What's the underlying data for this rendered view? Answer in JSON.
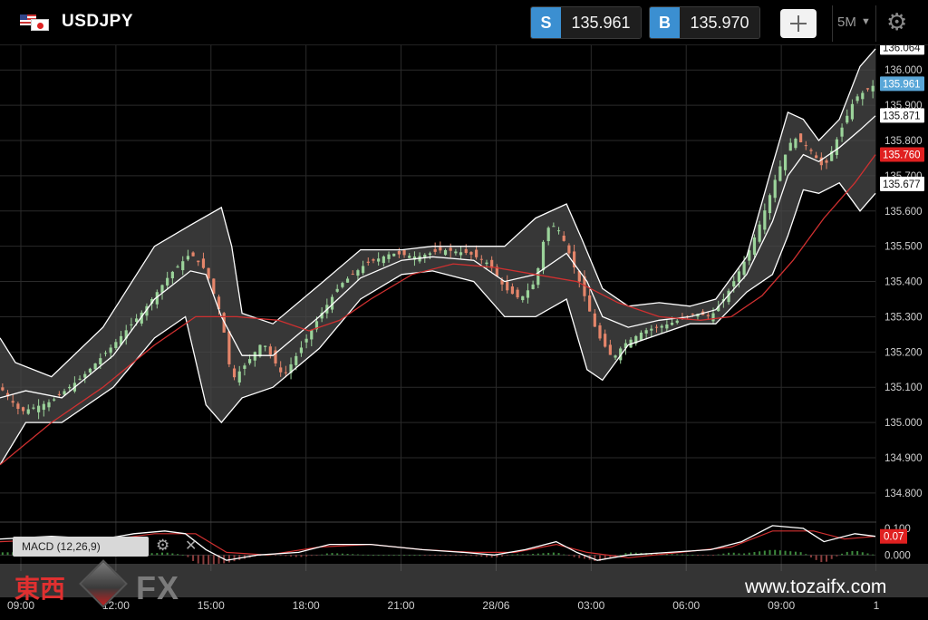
{
  "header": {
    "symbol": "USDJPY",
    "flags": [
      "us-flag",
      "jp-flag"
    ],
    "sell_tag": "S",
    "sell_price": "135.961",
    "buy_tag": "B",
    "buy_price": "135.970",
    "interval": "5M",
    "icons": [
      "crosshair-icon",
      "chevron-down-icon",
      "gear-icon"
    ]
  },
  "colors": {
    "accent": "#3b8fd1",
    "up_candle": "#9bd39a",
    "down_candle": "#e4856a",
    "band": "#ffffff",
    "ma_line": "#d03030",
    "price_tag_current": "#5aa7d8",
    "price_tag_red": "#e02020"
  },
  "macd": {
    "legend": "MACD (12,26,9)",
    "axis_labels": [
      "0.100",
      "0.000"
    ],
    "current_value": "0.07"
  },
  "watermark": {
    "kanji": "東西",
    "brand": "FX",
    "url": "www.tozaifx.com"
  },
  "chart_data": {
    "type": "candlestick",
    "title": "USDJPY",
    "interval": "5M",
    "y_ticks": [
      "136.000",
      "135.900",
      "135.800",
      "135.700",
      "135.600",
      "135.500",
      "135.400",
      "135.300",
      "135.200",
      "135.100",
      "135.000",
      "134.900",
      "134.800"
    ],
    "ylim": [
      134.72,
      136.07
    ],
    "x_ticks": [
      "09:00",
      "12:00",
      "15:00",
      "18:00",
      "21:00",
      "28/06",
      "03:00",
      "06:00",
      "09:00",
      "1"
    ],
    "price_labels": [
      {
        "label": "136.064",
        "value": 136.064,
        "style": "white"
      },
      {
        "label": "135.961",
        "value": 135.961,
        "style": "blue"
      },
      {
        "label": "135.871",
        "value": 135.871,
        "style": "white"
      },
      {
        "label": "135.760",
        "value": 135.76,
        "style": "red"
      },
      {
        "label": "135.677",
        "value": 135.677,
        "style": "white"
      }
    ],
    "close_path": [
      [
        0,
        135.1
      ],
      [
        4,
        135.03
      ],
      [
        10,
        135.06
      ],
      [
        16,
        135.13
      ],
      [
        22,
        135.22
      ],
      [
        28,
        135.32
      ],
      [
        33,
        135.42
      ],
      [
        37,
        135.48
      ],
      [
        40,
        135.43
      ],
      [
        43,
        135.3
      ],
      [
        45,
        135.12
      ],
      [
        48,
        135.17
      ],
      [
        51,
        135.23
      ],
      [
        55,
        135.13
      ],
      [
        58,
        135.2
      ],
      [
        62,
        135.3
      ],
      [
        66,
        135.39
      ],
      [
        71,
        135.45
      ],
      [
        76,
        135.48
      ],
      [
        81,
        135.47
      ],
      [
        86,
        135.49
      ],
      [
        91,
        135.48
      ],
      [
        95,
        135.45
      ],
      [
        98,
        135.38
      ],
      [
        101,
        135.35
      ],
      [
        104,
        135.4
      ],
      [
        106,
        135.55
      ],
      [
        108,
        135.56
      ],
      [
        110,
        135.5
      ],
      [
        113,
        135.38
      ],
      [
        116,
        135.25
      ],
      [
        119,
        135.18
      ],
      [
        121,
        135.22
      ],
      [
        125,
        135.26
      ],
      [
        130,
        135.28
      ],
      [
        135,
        135.31
      ],
      [
        138,
        135.3
      ],
      [
        141,
        135.36
      ],
      [
        145,
        135.47
      ],
      [
        148,
        135.58
      ],
      [
        151,
        135.71
      ],
      [
        154,
        135.81
      ],
      [
        157,
        135.78
      ],
      [
        160,
        135.72
      ],
      [
        163,
        135.82
      ],
      [
        166,
        135.92
      ],
      [
        170,
        135.96
      ]
    ],
    "bollinger_upper": [
      [
        0,
        135.24
      ],
      [
        3,
        135.17
      ],
      [
        10,
        135.13
      ],
      [
        20,
        135.27
      ],
      [
        30,
        135.5
      ],
      [
        37,
        135.56
      ],
      [
        43,
        135.61
      ],
      [
        45,
        135.5
      ],
      [
        47,
        135.31
      ],
      [
        53,
        135.28
      ],
      [
        62,
        135.39
      ],
      [
        70,
        135.49
      ],
      [
        78,
        135.49
      ],
      [
        84,
        135.5
      ],
      [
        92,
        135.5
      ],
      [
        98,
        135.5
      ],
      [
        104,
        135.58
      ],
      [
        110,
        135.62
      ],
      [
        113,
        135.52
      ],
      [
        117,
        135.38
      ],
      [
        122,
        135.33
      ],
      [
        128,
        135.34
      ],
      [
        134,
        135.33
      ],
      [
        139,
        135.35
      ],
      [
        145,
        135.47
      ],
      [
        150,
        135.73
      ],
      [
        153,
        135.88
      ],
      [
        156,
        135.86
      ],
      [
        159,
        135.8
      ],
      [
        163,
        135.86
      ],
      [
        167,
        136.01
      ],
      [
        170,
        136.06
      ]
    ],
    "bollinger_mid": [
      [
        0,
        135.07
      ],
      [
        5,
        135.09
      ],
      [
        12,
        135.07
      ],
      [
        22,
        135.19
      ],
      [
        30,
        135.35
      ],
      [
        37,
        135.43
      ],
      [
        40,
        135.42
      ],
      [
        43,
        135.3
      ],
      [
        47,
        135.19
      ],
      [
        53,
        135.19
      ],
      [
        62,
        135.3
      ],
      [
        70,
        135.41
      ],
      [
        78,
        135.46
      ],
      [
        84,
        135.47
      ],
      [
        92,
        135.46
      ],
      [
        98,
        135.4
      ],
      [
        104,
        135.42
      ],
      [
        110,
        135.48
      ],
      [
        114,
        135.4
      ],
      [
        117,
        135.3
      ],
      [
        122,
        135.27
      ],
      [
        128,
        135.29
      ],
      [
        134,
        135.3
      ],
      [
        139,
        135.32
      ],
      [
        145,
        135.42
      ],
      [
        150,
        135.57
      ],
      [
        153,
        135.7
      ],
      [
        156,
        135.76
      ],
      [
        159,
        135.74
      ],
      [
        163,
        135.78
      ],
      [
        167,
        135.83
      ],
      [
        170,
        135.87
      ]
    ],
    "bollinger_lower": [
      [
        0,
        134.88
      ],
      [
        5,
        135.0
      ],
      [
        12,
        135.0
      ],
      [
        22,
        135.1
      ],
      [
        30,
        135.24
      ],
      [
        36,
        135.3
      ],
      [
        40,
        135.05
      ],
      [
        43,
        135.0
      ],
      [
        47,
        135.07
      ],
      [
        53,
        135.1
      ],
      [
        62,
        135.21
      ],
      [
        70,
        135.35
      ],
      [
        78,
        135.42
      ],
      [
        84,
        135.43
      ],
      [
        92,
        135.4
      ],
      [
        98,
        135.3
      ],
      [
        104,
        135.3
      ],
      [
        110,
        135.35
      ],
      [
        114,
        135.15
      ],
      [
        117,
        135.12
      ],
      [
        122,
        135.22
      ],
      [
        128,
        135.25
      ],
      [
        134,
        135.28
      ],
      [
        139,
        135.28
      ],
      [
        145,
        135.37
      ],
      [
        150,
        135.42
      ],
      [
        153,
        135.53
      ],
      [
        156,
        135.66
      ],
      [
        159,
        135.65
      ],
      [
        163,
        135.68
      ],
      [
        167,
        135.6
      ],
      [
        170,
        135.65
      ]
    ],
    "moving_average": [
      [
        0,
        134.88
      ],
      [
        10,
        135.0
      ],
      [
        20,
        135.1
      ],
      [
        30,
        135.22
      ],
      [
        38,
        135.3
      ],
      [
        46,
        135.3
      ],
      [
        54,
        135.29
      ],
      [
        60,
        135.26
      ],
      [
        66,
        135.29
      ],
      [
        72,
        135.35
      ],
      [
        80,
        135.42
      ],
      [
        88,
        135.45
      ],
      [
        96,
        135.44
      ],
      [
        104,
        135.42
      ],
      [
        112,
        135.4
      ],
      [
        120,
        135.34
      ],
      [
        128,
        135.3
      ],
      [
        136,
        135.29
      ],
      [
        142,
        135.3
      ],
      [
        148,
        135.36
      ],
      [
        154,
        135.46
      ],
      [
        160,
        135.58
      ],
      [
        166,
        135.68
      ],
      [
        170,
        135.76
      ]
    ],
    "macd_line": [
      [
        0,
        0.06
      ],
      [
        10,
        0.07
      ],
      [
        20,
        0.06
      ],
      [
        26,
        0.08
      ],
      [
        32,
        0.09
      ],
      [
        36,
        0.08
      ],
      [
        40,
        0.02
      ],
      [
        44,
        -0.02
      ],
      [
        50,
        0.0
      ],
      [
        58,
        0.01
      ],
      [
        64,
        0.04
      ],
      [
        72,
        0.04
      ],
      [
        82,
        0.02
      ],
      [
        90,
        0.01
      ],
      [
        96,
        0.0
      ],
      [
        102,
        0.02
      ],
      [
        108,
        0.05
      ],
      [
        112,
        0.01
      ],
      [
        116,
        -0.02
      ],
      [
        122,
        0.0
      ],
      [
        130,
        0.01
      ],
      [
        138,
        0.02
      ],
      [
        144,
        0.05
      ],
      [
        150,
        0.11
      ],
      [
        156,
        0.1
      ],
      [
        160,
        0.05
      ],
      [
        166,
        0.08
      ],
      [
        170,
        0.07
      ]
    ],
    "macd_signal": [
      [
        0,
        0.05
      ],
      [
        12,
        0.06
      ],
      [
        22,
        0.06
      ],
      [
        30,
        0.08
      ],
      [
        38,
        0.08
      ],
      [
        44,
        0.01
      ],
      [
        52,
        0.0
      ],
      [
        62,
        0.03
      ],
      [
        72,
        0.04
      ],
      [
        82,
        0.02
      ],
      [
        92,
        0.01
      ],
      [
        100,
        0.01
      ],
      [
        108,
        0.04
      ],
      [
        114,
        0.01
      ],
      [
        122,
        -0.01
      ],
      [
        132,
        0.01
      ],
      [
        142,
        0.03
      ],
      [
        150,
        0.09
      ],
      [
        158,
        0.09
      ],
      [
        164,
        0.06
      ],
      [
        170,
        0.07
      ]
    ],
    "macd_ylim": [
      -0.06,
      0.12
    ],
    "x_range": [
      0,
      170
    ]
  }
}
